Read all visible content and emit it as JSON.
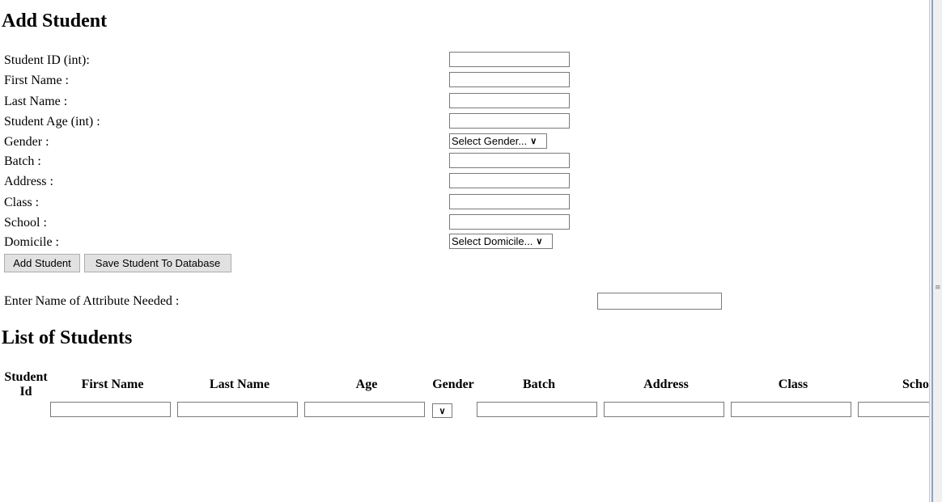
{
  "add_section": {
    "title": "Add Student",
    "fields": [
      {
        "label": "Student ID (int):",
        "type": "text",
        "value": ""
      },
      {
        "label": "First Name :",
        "type": "text",
        "value": ""
      },
      {
        "label": "Last Name :",
        "type": "text",
        "value": ""
      },
      {
        "label": "Student Age (int) :",
        "type": "text",
        "value": ""
      },
      {
        "label": "Gender :",
        "type": "select",
        "selected": "Select Gender..."
      },
      {
        "label": "Batch :",
        "type": "text",
        "value": ""
      },
      {
        "label": "Address :",
        "type": "text",
        "value": ""
      },
      {
        "label": "Class :",
        "type": "text",
        "value": ""
      },
      {
        "label": "School :",
        "type": "text",
        "value": ""
      },
      {
        "label": "Domicile :",
        "type": "select",
        "selected": "Select Domicile..."
      }
    ],
    "buttons": {
      "add": "Add Student",
      "save": "Save Student To Database"
    }
  },
  "attribute": {
    "label": "Enter Name of Attribute Needed :",
    "value": ""
  },
  "list_section": {
    "title": "List of Students",
    "columns": [
      "Student Id",
      "First Name",
      "Last Name",
      "Age",
      "Gender",
      "Batch",
      "Address",
      "Class",
      "Scho"
    ]
  }
}
